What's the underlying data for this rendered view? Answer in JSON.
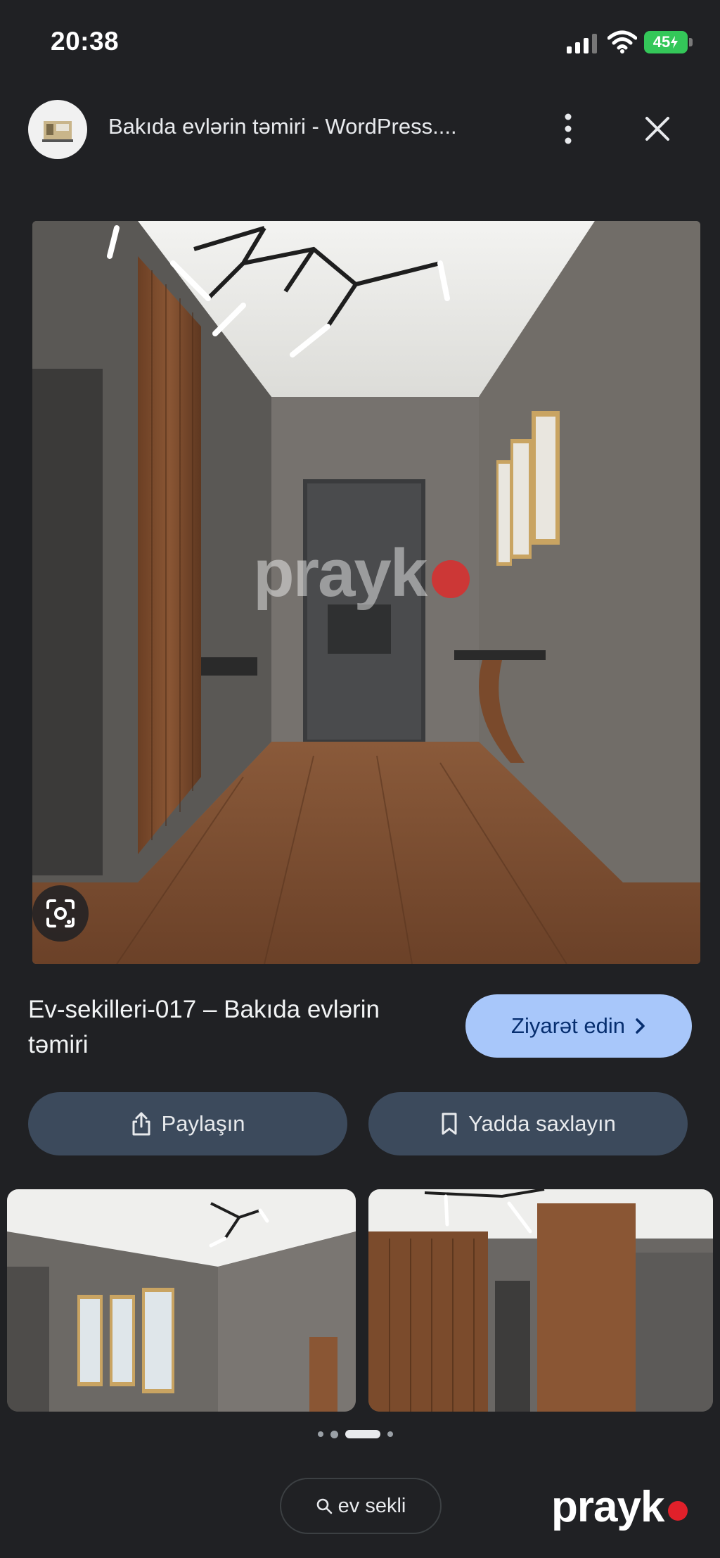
{
  "status_bar": {
    "time": "20:38",
    "battery": "45"
  },
  "header": {
    "title": "Bakıda evlərin təmiri - WordPress...."
  },
  "image_watermark": "prayk",
  "result": {
    "title": "Ev-sekilleri-017 – Bakıda evlərin təmiri",
    "visit_label": "Ziyarət edin"
  },
  "actions": {
    "share_label": "Paylaşın",
    "save_label": "Yadda saxlayın"
  },
  "query_chip": {
    "label": "ev sekli"
  },
  "watermark": {
    "text": "prayk"
  },
  "colors": {
    "background": "#202124",
    "visit_button": "#a8c7fa",
    "action_button": "#3c4a5c",
    "watermark_dot": "#e0202a"
  }
}
